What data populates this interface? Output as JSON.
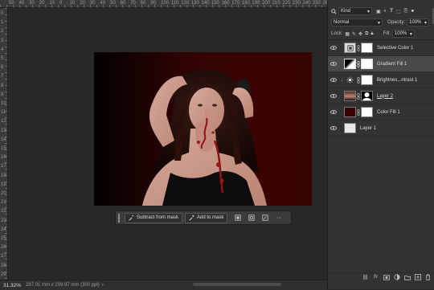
{
  "rulers": {
    "top": [
      {
        "label": "50"
      },
      {
        "label": "40"
      },
      {
        "label": "30"
      },
      {
        "label": "20"
      },
      {
        "label": "10"
      },
      {
        "label": "0"
      },
      {
        "label": "10"
      },
      {
        "label": "20"
      },
      {
        "label": "30"
      },
      {
        "label": "40"
      },
      {
        "label": "50"
      },
      {
        "label": "60"
      },
      {
        "label": "70"
      },
      {
        "label": "80"
      },
      {
        "label": "90"
      },
      {
        "label": "100"
      },
      {
        "label": "110"
      },
      {
        "label": "120"
      },
      {
        "label": "130"
      },
      {
        "label": "140"
      },
      {
        "label": "150"
      },
      {
        "label": "160"
      },
      {
        "label": "170"
      },
      {
        "label": "180"
      },
      {
        "label": "190"
      },
      {
        "label": "200"
      },
      {
        "label": "210"
      },
      {
        "label": "220"
      },
      {
        "label": "230"
      },
      {
        "label": "240"
      },
      {
        "label": "250"
      },
      {
        "label": "260"
      }
    ],
    "left": [
      "0",
      "1",
      "2",
      "3",
      "4",
      "5",
      "6",
      "7",
      "8",
      "9",
      "10",
      "11",
      "12",
      "13",
      "14",
      "15",
      "16",
      "17",
      "18",
      "19",
      "20",
      "21",
      "22",
      "23",
      "24",
      "25",
      "26",
      "27",
      "28",
      "29"
    ]
  },
  "context_bar": {
    "subtract_label": "Subtract from mask",
    "add_label": "Add to mask",
    "more_label": "···"
  },
  "status": {
    "zoom": "31.32%",
    "doc_info": "287.01 mm x 209.97 mm (300 ppi)",
    "arrow": "›"
  },
  "layers_panel": {
    "filter_kind": "Kind",
    "blend_mode": "Normal",
    "opacity_label": "Opacity:",
    "opacity_value": "100%",
    "lock_label": "Lock:",
    "fill_label": "Fill:",
    "fill_value": "100%",
    "layers": [
      {
        "name": "Selective Color 1",
        "thumb": "adjustment",
        "mask": "white",
        "active": false
      },
      {
        "name": "Gradient Fill 1",
        "thumb": "gradient",
        "mask": "white",
        "active": true
      },
      {
        "name": "Brightnes...ntrast 1",
        "thumb": "brightness",
        "mask": "white",
        "active": false,
        "clipped": true
      },
      {
        "name": "Layer 2",
        "thumb": "photo",
        "mask": "silhouette",
        "active": false,
        "underline": true
      },
      {
        "name": "Color Fill 1",
        "thumb": "colorfill",
        "mask": "white",
        "active": false
      },
      {
        "name": "Layer 1",
        "thumb": "blank",
        "mask": "none",
        "active": false
      }
    ]
  },
  "colors": {
    "accent_selected": "#4a4a4a",
    "fill_red": "#3a0303"
  }
}
